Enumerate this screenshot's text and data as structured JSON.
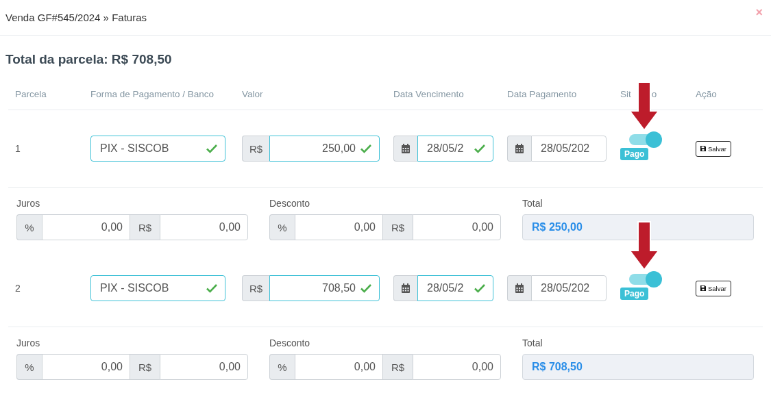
{
  "window": {
    "title": "Venda GF#545/2024 » Faturas",
    "close": "×"
  },
  "heading": "Total da parcela: R$ 708,50",
  "columns": [
    {
      "label": "Parcela"
    },
    {
      "label": "Forma de Pagamento / Banco"
    },
    {
      "label": "Valor"
    },
    {
      "label": "Data Vencimento"
    },
    {
      "label": "Data Pagamento"
    },
    {
      "parts": [
        "Sit",
        "o"
      ]
    },
    {
      "label": "Ação"
    }
  ],
  "rows": [
    {
      "parcela": "1",
      "method": {
        "value": "PIX - SISCOB",
        "valid": true
      },
      "currency": "R$",
      "amount": {
        "value": "250,00",
        "valid": true
      },
      "due": {
        "value": "28/05/2",
        "valid": true
      },
      "paid_date": {
        "value": "28/05/202",
        "valid": false
      },
      "paid": {
        "on": true,
        "label": "Pago"
      },
      "save": "Salvar",
      "arrow": true,
      "juros_label": "Juros",
      "juros_pct_addon": "%",
      "juros_pct": "0,00",
      "juros_cur_addon": "R$",
      "juros_val": "0,00",
      "desconto_label": "Desconto",
      "desconto_pct_addon": "%",
      "desconto_pct": "0,00",
      "desconto_cur_addon": "R$",
      "desconto_val": "0,00",
      "total_label": "Total",
      "total": "R$ 250,00"
    },
    {
      "parcela": "2",
      "method": {
        "value": "PIX - SISCOB",
        "valid": true
      },
      "currency": "R$",
      "amount": {
        "value": "708,50",
        "valid": true
      },
      "due": {
        "value": "28/05/2",
        "valid": true
      },
      "paid_date": {
        "value": "28/05/202",
        "valid": false
      },
      "paid": {
        "on": true,
        "label": "Pago"
      },
      "save": "Salvar",
      "arrow": true,
      "juros_label": "Juros",
      "juros_pct_addon": "%",
      "juros_pct": "0,00",
      "juros_cur_addon": "R$",
      "juros_val": "0,00",
      "desconto_label": "Desconto",
      "desconto_pct_addon": "%",
      "desconto_pct": "0,00",
      "desconto_cur_addon": "R$",
      "desconto_val": "0,00",
      "total_label": "Total",
      "total": "R$ 708,50"
    }
  ]
}
